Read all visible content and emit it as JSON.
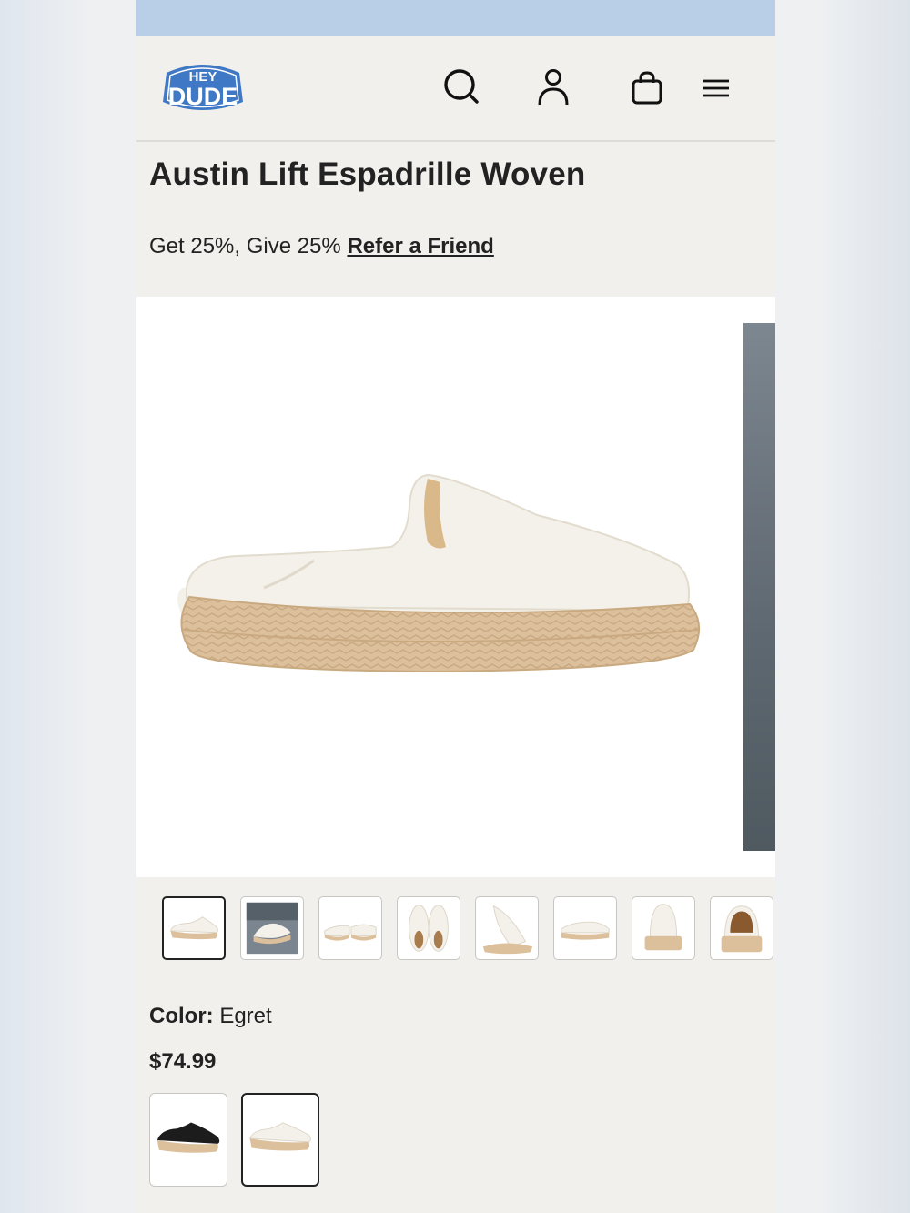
{
  "promo_bar": {
    "text": ""
  },
  "header": {
    "logo_top": "HEY",
    "logo_main": "DUDE",
    "icons": [
      "search-icon",
      "account-icon",
      "bag-icon",
      "menu-icon"
    ]
  },
  "product": {
    "title": "Austin Lift Espadrille Woven",
    "refer_prefix": "Get 25%, Give 25%",
    "refer_link": "Refer a Friend",
    "color_label": "Color:",
    "color_value": "Egret",
    "price": "$74.99"
  },
  "gallery": {
    "active_index": 0,
    "thumbnail_count": 8
  },
  "swatches": [
    {
      "name": "black",
      "selected": false
    },
    {
      "name": "Egret",
      "selected": true
    }
  ],
  "colors": {
    "promo_bar": "#b9cfe8",
    "page_bg": "#f1f0ed",
    "text": "#222222",
    "logo_blue": "#3f78c4",
    "sole_tan": "#dcc09c",
    "upper_cream": "#f4f1ea"
  }
}
